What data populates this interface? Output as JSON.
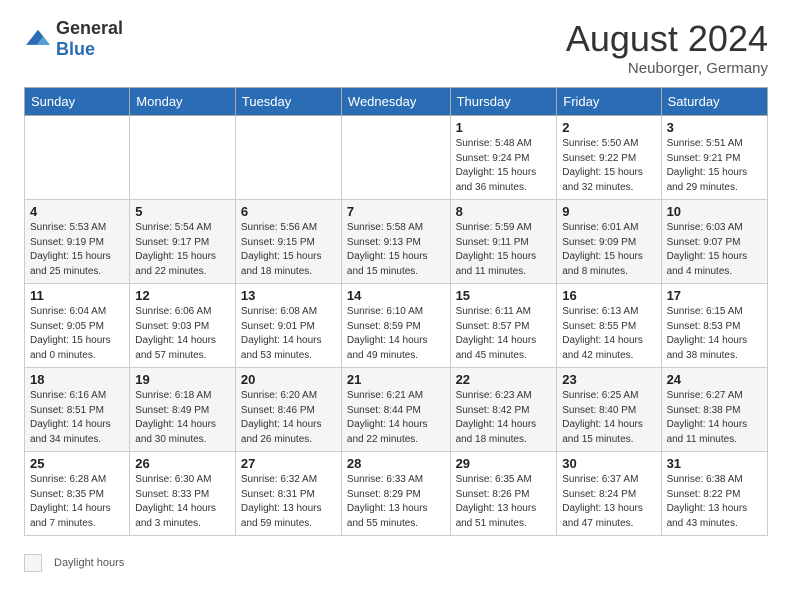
{
  "header": {
    "logo_general": "General",
    "logo_blue": "Blue",
    "month_year": "August 2024",
    "location": "Neuborger, Germany"
  },
  "days_of_week": [
    "Sunday",
    "Monday",
    "Tuesday",
    "Wednesday",
    "Thursday",
    "Friday",
    "Saturday"
  ],
  "weeks": [
    [
      {
        "day": "",
        "info": ""
      },
      {
        "day": "",
        "info": ""
      },
      {
        "day": "",
        "info": ""
      },
      {
        "day": "",
        "info": ""
      },
      {
        "day": "1",
        "info": "Sunrise: 5:48 AM\nSunset: 9:24 PM\nDaylight: 15 hours\nand 36 minutes."
      },
      {
        "day": "2",
        "info": "Sunrise: 5:50 AM\nSunset: 9:22 PM\nDaylight: 15 hours\nand 32 minutes."
      },
      {
        "day": "3",
        "info": "Sunrise: 5:51 AM\nSunset: 9:21 PM\nDaylight: 15 hours\nand 29 minutes."
      }
    ],
    [
      {
        "day": "4",
        "info": "Sunrise: 5:53 AM\nSunset: 9:19 PM\nDaylight: 15 hours\nand 25 minutes."
      },
      {
        "day": "5",
        "info": "Sunrise: 5:54 AM\nSunset: 9:17 PM\nDaylight: 15 hours\nand 22 minutes."
      },
      {
        "day": "6",
        "info": "Sunrise: 5:56 AM\nSunset: 9:15 PM\nDaylight: 15 hours\nand 18 minutes."
      },
      {
        "day": "7",
        "info": "Sunrise: 5:58 AM\nSunset: 9:13 PM\nDaylight: 15 hours\nand 15 minutes."
      },
      {
        "day": "8",
        "info": "Sunrise: 5:59 AM\nSunset: 9:11 PM\nDaylight: 15 hours\nand 11 minutes."
      },
      {
        "day": "9",
        "info": "Sunrise: 6:01 AM\nSunset: 9:09 PM\nDaylight: 15 hours\nand 8 minutes."
      },
      {
        "day": "10",
        "info": "Sunrise: 6:03 AM\nSunset: 9:07 PM\nDaylight: 15 hours\nand 4 minutes."
      }
    ],
    [
      {
        "day": "11",
        "info": "Sunrise: 6:04 AM\nSunset: 9:05 PM\nDaylight: 15 hours\nand 0 minutes."
      },
      {
        "day": "12",
        "info": "Sunrise: 6:06 AM\nSunset: 9:03 PM\nDaylight: 14 hours\nand 57 minutes."
      },
      {
        "day": "13",
        "info": "Sunrise: 6:08 AM\nSunset: 9:01 PM\nDaylight: 14 hours\nand 53 minutes."
      },
      {
        "day": "14",
        "info": "Sunrise: 6:10 AM\nSunset: 8:59 PM\nDaylight: 14 hours\nand 49 minutes."
      },
      {
        "day": "15",
        "info": "Sunrise: 6:11 AM\nSunset: 8:57 PM\nDaylight: 14 hours\nand 45 minutes."
      },
      {
        "day": "16",
        "info": "Sunrise: 6:13 AM\nSunset: 8:55 PM\nDaylight: 14 hours\nand 42 minutes."
      },
      {
        "day": "17",
        "info": "Sunrise: 6:15 AM\nSunset: 8:53 PM\nDaylight: 14 hours\nand 38 minutes."
      }
    ],
    [
      {
        "day": "18",
        "info": "Sunrise: 6:16 AM\nSunset: 8:51 PM\nDaylight: 14 hours\nand 34 minutes."
      },
      {
        "day": "19",
        "info": "Sunrise: 6:18 AM\nSunset: 8:49 PM\nDaylight: 14 hours\nand 30 minutes."
      },
      {
        "day": "20",
        "info": "Sunrise: 6:20 AM\nSunset: 8:46 PM\nDaylight: 14 hours\nand 26 minutes."
      },
      {
        "day": "21",
        "info": "Sunrise: 6:21 AM\nSunset: 8:44 PM\nDaylight: 14 hours\nand 22 minutes."
      },
      {
        "day": "22",
        "info": "Sunrise: 6:23 AM\nSunset: 8:42 PM\nDaylight: 14 hours\nand 18 minutes."
      },
      {
        "day": "23",
        "info": "Sunrise: 6:25 AM\nSunset: 8:40 PM\nDaylight: 14 hours\nand 15 minutes."
      },
      {
        "day": "24",
        "info": "Sunrise: 6:27 AM\nSunset: 8:38 PM\nDaylight: 14 hours\nand 11 minutes."
      }
    ],
    [
      {
        "day": "25",
        "info": "Sunrise: 6:28 AM\nSunset: 8:35 PM\nDaylight: 14 hours\nand 7 minutes."
      },
      {
        "day": "26",
        "info": "Sunrise: 6:30 AM\nSunset: 8:33 PM\nDaylight: 14 hours\nand 3 minutes."
      },
      {
        "day": "27",
        "info": "Sunrise: 6:32 AM\nSunset: 8:31 PM\nDaylight: 13 hours\nand 59 minutes."
      },
      {
        "day": "28",
        "info": "Sunrise: 6:33 AM\nSunset: 8:29 PM\nDaylight: 13 hours\nand 55 minutes."
      },
      {
        "day": "29",
        "info": "Sunrise: 6:35 AM\nSunset: 8:26 PM\nDaylight: 13 hours\nand 51 minutes."
      },
      {
        "day": "30",
        "info": "Sunrise: 6:37 AM\nSunset: 8:24 PM\nDaylight: 13 hours\nand 47 minutes."
      },
      {
        "day": "31",
        "info": "Sunrise: 6:38 AM\nSunset: 8:22 PM\nDaylight: 13 hours\nand 43 minutes."
      }
    ]
  ],
  "legend": {
    "box_label": "Daylight hours"
  }
}
